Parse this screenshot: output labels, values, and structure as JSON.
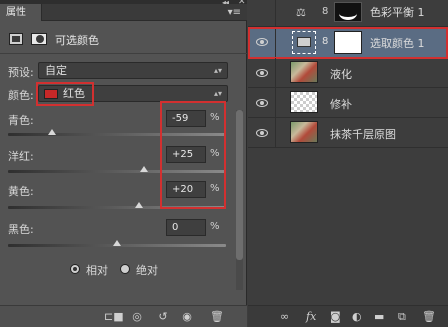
{
  "properties_panel": {
    "tab_label": "属性",
    "header_title": "可选颜色",
    "preset_label": "预设:",
    "preset_value": "自定",
    "colors_label": "颜色:",
    "color_value": "红色",
    "color_swatch": "#c82828",
    "sliders": [
      {
        "label": "青色:",
        "value": "-59",
        "unit": "%",
        "level": 0.2
      },
      {
        "label": "洋红:",
        "value": "+25",
        "unit": "%",
        "level": 0.625
      },
      {
        "label": "黄色:",
        "value": "+20",
        "unit": "%",
        "level": 0.6
      },
      {
        "label": "黑色:",
        "value": "0",
        "unit": "%",
        "level": 0.5
      }
    ],
    "method_options": [
      "相对",
      "绝对"
    ],
    "method_selected": "相对",
    "highlight_color": "#d23030"
  },
  "layers_panel": {
    "layers": [
      {
        "name": "色彩平衡 1",
        "visible": false
      },
      {
        "name": "选取颜色 1",
        "visible": true,
        "selected": true
      },
      {
        "name": "液化",
        "visible": true
      },
      {
        "name": "修补",
        "visible": true
      },
      {
        "name": "抹茶千层原图",
        "visible": true
      }
    ],
    "selected_color": "#5a6c83"
  },
  "icons": {
    "panel_menu": "menu-icon",
    "eye": "eye-icon",
    "chain": "link-icon"
  }
}
